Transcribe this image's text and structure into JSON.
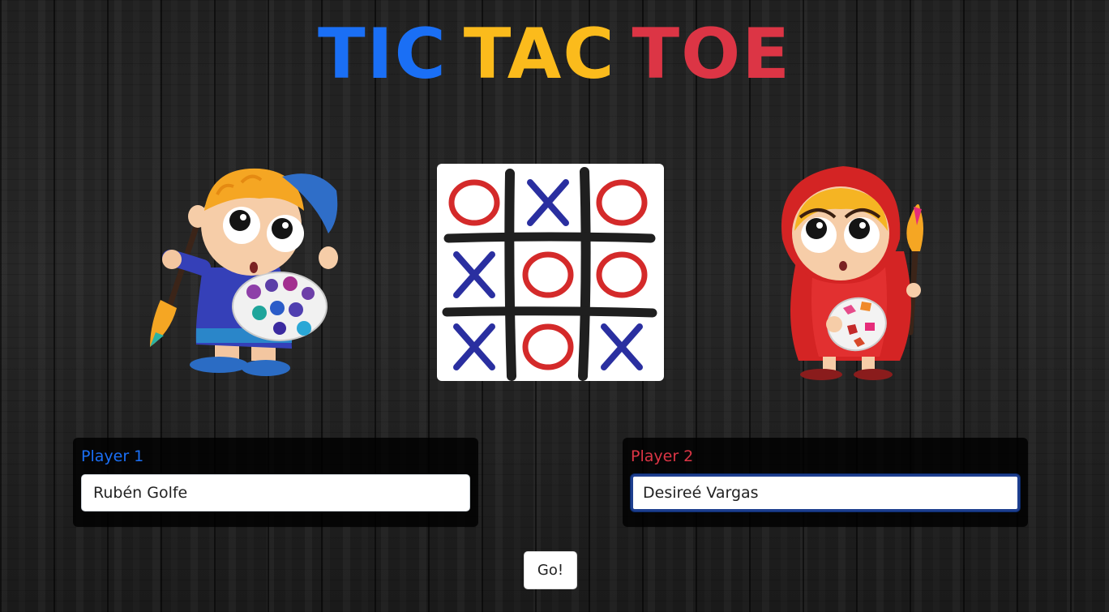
{
  "title": {
    "words": [
      "TIC",
      "TAC",
      "TOE"
    ],
    "colors": [
      "#1a6ff5",
      "#fbbb1c",
      "#dc3545"
    ]
  },
  "board_grid": [
    [
      "O",
      "X",
      "O"
    ],
    [
      "X",
      "O",
      "O"
    ],
    [
      "X",
      "O",
      "X"
    ]
  ],
  "mark_colors": {
    "X": "#2a2fa0",
    "O": "#d42a2a"
  },
  "players": {
    "p1": {
      "label": "Player 1",
      "name": "Rubén Golfe",
      "color": "#1a6ff5",
      "icon": "boy-painter-icon"
    },
    "p2": {
      "label": "Player 2",
      "name": "Desireé Vargas",
      "color": "#dc3545",
      "icon": "girl-painter-icon"
    }
  },
  "go_button": {
    "label": "Go!"
  }
}
